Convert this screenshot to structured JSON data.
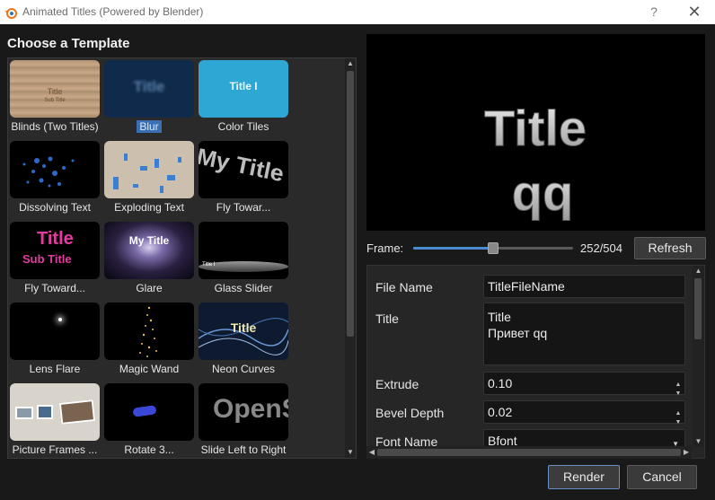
{
  "window": {
    "title": "Animated Titles (Powered by Blender)",
    "help_glyph": "?",
    "close_glyph": "✕"
  },
  "left": {
    "heading": "Choose a Template",
    "templates": [
      {
        "label": "Blinds (Two Titles)",
        "thumb_text": "Title",
        "thumb_sub": "Sub Title",
        "selected": false
      },
      {
        "label": "Blur",
        "thumb_text": "Title",
        "selected": true
      },
      {
        "label": "Color Tiles",
        "thumb_text": "Title I",
        "selected": false
      },
      {
        "label": "Dissolving Text",
        "selected": false
      },
      {
        "label": "Exploding Text",
        "selected": false
      },
      {
        "label": "Fly Towar...",
        "thumb_text": "My Title",
        "selected": false
      },
      {
        "label": "Fly Toward...",
        "thumb_text": "Title",
        "thumb_sub": "Sub Title",
        "selected": false
      },
      {
        "label": "Glare",
        "thumb_text": "My Title",
        "selected": false
      },
      {
        "label": "Glass Slider",
        "thumb_text": "Title I",
        "selected": false
      },
      {
        "label": "Lens Flare",
        "selected": false
      },
      {
        "label": "Magic Wand",
        "selected": false
      },
      {
        "label": "Neon Curves",
        "thumb_text": "Title",
        "selected": false
      },
      {
        "label": "Picture Frames ...",
        "selected": false
      },
      {
        "label": "Rotate 3...",
        "selected": false
      },
      {
        "label": "Slide Left to Right",
        "thumb_text": "OpenS",
        "selected": false
      }
    ]
  },
  "preview": {
    "line1": "Title",
    "line2": "qq"
  },
  "frame": {
    "label": "Frame:",
    "value_text": "252/504",
    "current": 252,
    "total": 504,
    "refresh_label": "Refresh"
  },
  "props": {
    "file_name_label": "File Name",
    "file_name_value": "TitleFileName",
    "title_label": "Title",
    "title_line1": "Title",
    "title_line2": "Привет qq",
    "extrude_label": "Extrude",
    "extrude_value": "0.10",
    "bevel_label": "Bevel Depth",
    "bevel_value": "0.02",
    "font_label": "Font Name",
    "font_value": "Bfont"
  },
  "footer": {
    "render_label": "Render",
    "cancel_label": "Cancel"
  },
  "colors": {
    "accent": "#3a6fb4",
    "background": "#191919",
    "slider_fill": "#4a8ad0"
  }
}
